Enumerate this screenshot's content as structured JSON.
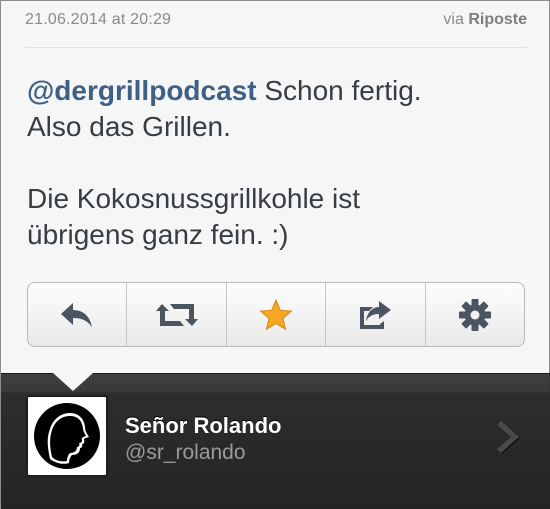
{
  "header": {
    "timestamp": "21.06.2014 at 20:29",
    "via_prefix": "via",
    "via_app": "Riposte"
  },
  "tweet": {
    "mention": "@dergrillpodcast",
    "line1_rest": " Schon fertig.",
    "line2": "Also das Grillen.",
    "line3": "Die Kokosnussgrillkohle ist",
    "line4": "übrigens ganz fein. :)"
  },
  "actions": [
    {
      "icon": "reply-icon"
    },
    {
      "icon": "retweet-icon"
    },
    {
      "icon": "star-icon",
      "color": "#f5a623"
    },
    {
      "icon": "share-icon"
    },
    {
      "icon": "gear-icon"
    }
  ],
  "author": {
    "name": "Señor Rolando",
    "handle": "@sr_rolando"
  },
  "colors": {
    "mention": "#3e5f86",
    "text": "#363d44",
    "icon": "#4a5561",
    "star": "#f5a623",
    "profile_bg": "#2d2d2d"
  }
}
